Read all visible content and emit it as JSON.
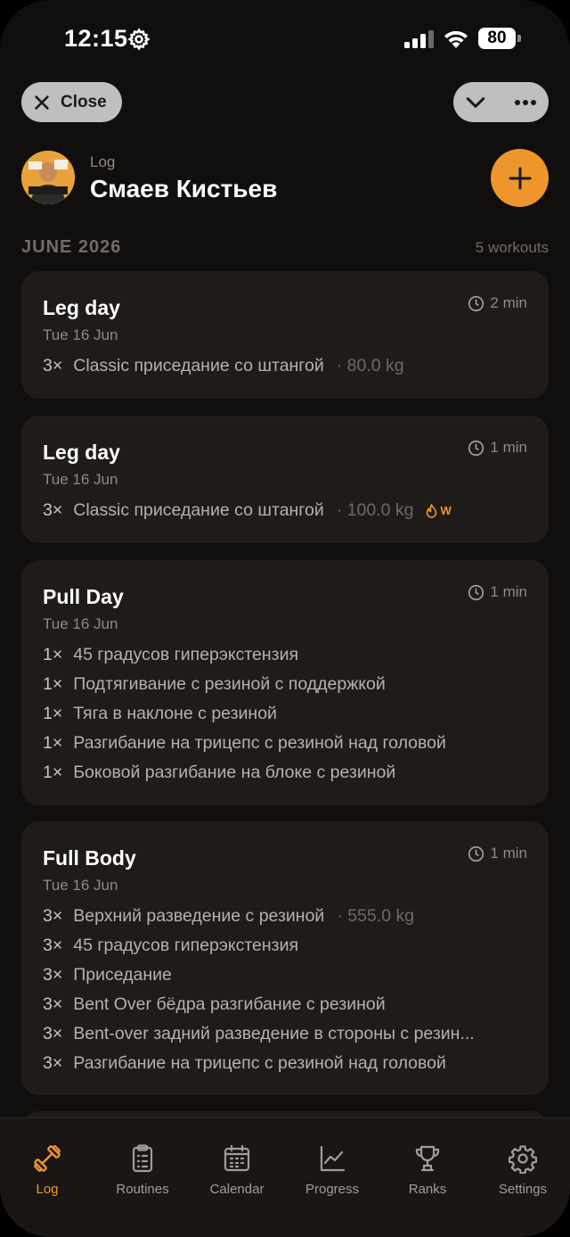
{
  "status_bar": {
    "time": "12:15",
    "battery": "80"
  },
  "top_bar": {
    "close_label": "Close"
  },
  "header": {
    "section_label": "Log",
    "user_name": "Смаев Кистьев"
  },
  "month": {
    "label": "JUNE 2026",
    "count": "5 workouts"
  },
  "accent_color": "#ee962c",
  "workouts": [
    {
      "title": "Leg day",
      "date": "Tue 16 Jun",
      "duration": "2 min",
      "exercises": [
        {
          "sets": "3×",
          "name": "Classic приседание со штангой",
          "weight": "· 80.0 kg"
        }
      ]
    },
    {
      "title": "Leg day",
      "date": "Tue 16 Jun",
      "duration": "1 min",
      "exercises": [
        {
          "sets": "3×",
          "name": "Classic приседание со штангой",
          "weight": "· 100.0 kg",
          "badge": "W"
        }
      ]
    },
    {
      "title": "Pull Day",
      "date": "Tue 16 Jun",
      "duration": "1 min",
      "exercises": [
        {
          "sets": "1×",
          "name": "45 градусов гиперэкстензия"
        },
        {
          "sets": "1×",
          "name": "Подтягивание с резиной с поддержкой"
        },
        {
          "sets": "1×",
          "name": "Тяга в наклоне с резиной"
        },
        {
          "sets": "1×",
          "name": "Разгибание на трицепс с резиной над головой"
        },
        {
          "sets": "1×",
          "name": "Боковой разгибание на блоке с резиной"
        }
      ]
    },
    {
      "title": "Full Body",
      "date": "Tue 16 Jun",
      "duration": "1 min",
      "exercises": [
        {
          "sets": "3×",
          "name": "Верхний разведение с резиной",
          "weight": "· 555.0 kg"
        },
        {
          "sets": "3×",
          "name": "45 градусов гиперэкстензия"
        },
        {
          "sets": "3×",
          "name": "Приседание"
        },
        {
          "sets": "3×",
          "name": "Bent Over бёдра разгибание с резиной"
        },
        {
          "sets": "3×",
          "name": "Bent-over задний разведение в стороны с резин..."
        },
        {
          "sets": "3×",
          "name": "Разгибание на трицепс с резиной над головой"
        }
      ]
    }
  ],
  "tabs": [
    {
      "label": "Log",
      "icon": "dumbbell-icon",
      "active": true
    },
    {
      "label": "Routines",
      "icon": "clipboard-icon"
    },
    {
      "label": "Calendar",
      "icon": "calendar-icon"
    },
    {
      "label": "Progress",
      "icon": "chart-icon"
    },
    {
      "label": "Ranks",
      "icon": "trophy-icon"
    },
    {
      "label": "Settings",
      "icon": "gear-icon"
    }
  ]
}
